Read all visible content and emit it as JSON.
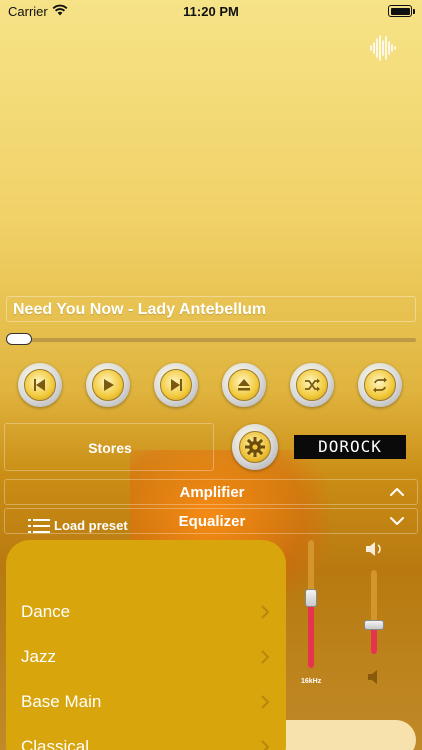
{
  "status_bar": {
    "carrier": "Carrier",
    "time": "11:20 PM"
  },
  "now_playing": {
    "title": "Need You Now - Lady Antebellum",
    "progress": 0.0
  },
  "transport": {
    "buttons": [
      "previous-icon",
      "play-icon",
      "next-icon",
      "eject-icon",
      "shuffle-icon",
      "repeat-icon"
    ]
  },
  "controls": {
    "stores_label": "Stores",
    "logo_text": "DOROCK"
  },
  "sections": {
    "amplifier": "Amplifier",
    "equalizer": "Equalizer"
  },
  "preset": {
    "load_label": "Load preset",
    "items": [
      "Dance",
      "Jazz",
      "Base Main",
      "Classical"
    ]
  },
  "equalizer": {
    "band_label": "16kHz",
    "level": 0.55
  },
  "volume": {
    "level": 0.35
  },
  "colors": {
    "accent": "#e8334f",
    "menu_bg": "#d8a50c",
    "text": "#ffffff"
  }
}
